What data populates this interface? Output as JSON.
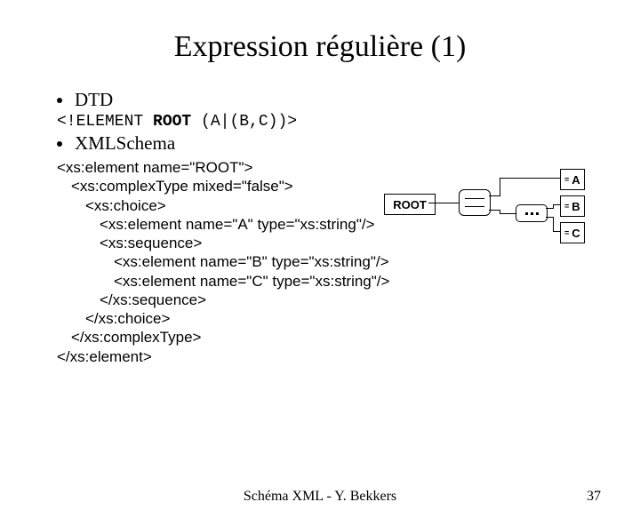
{
  "title": "Expression régulière (1)",
  "bullets": {
    "dtd": "DTD",
    "xmlschema": "XMLSchema"
  },
  "dtd_code": {
    "pre": "<!ELEMENT ",
    "kw": "ROOT",
    "post": " (A|(B,C))>"
  },
  "xml": {
    "l1": "<xs:element name=\"ROOT\">",
    "l2": "<xs:complexType mixed=\"false\">",
    "l3": "<xs:choice>",
    "l4": "<xs:element name=\"A\" type=\"xs:string\"/>",
    "l5": "<xs:sequence>",
    "l6": "<xs:element name=\"B\" type=\"xs:string\"/>",
    "l7": "<xs:element name=\"C\" type=\"xs:string\"/>",
    "l8": "</xs:sequence>",
    "l9": "</xs:choice>",
    "l10": "</xs:complexType>",
    "l11": "</xs:element>"
  },
  "diagram": {
    "root": "ROOT",
    "a": "A",
    "b": "B",
    "c": "C",
    "hint": "="
  },
  "footer": {
    "center": "Schéma XML - Y. Bekkers",
    "page": "37"
  }
}
